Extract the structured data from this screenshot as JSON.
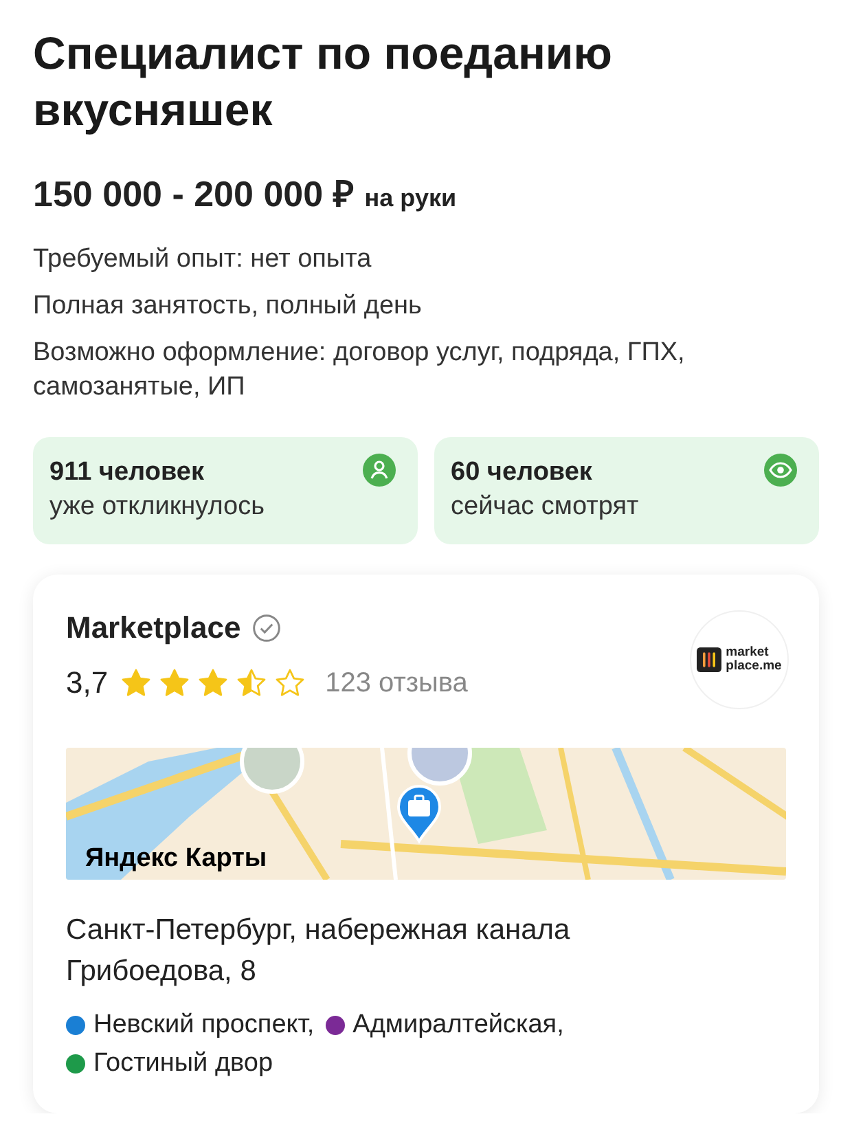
{
  "vacancy": {
    "title": "Специалист по поеданию вкусняшек",
    "salary": "150 000 - 200 000 ₽",
    "salary_note": "на руки"
  },
  "details": [
    "Требуемый опыт: нет опыта",
    "Полная занятость, полный день",
    "Возможно оформление: договор услуг, подряда, ГПХ, самозанятые, ИП"
  ],
  "stats": [
    {
      "kind": "person",
      "value": "911 человек",
      "label": "уже откликнулось"
    },
    {
      "kind": "eye",
      "value": "60 человек",
      "label": "сейчас смотрят"
    }
  ],
  "company": {
    "name": "Marketplace",
    "verified": true,
    "rating": "3,7",
    "stars": 3.5,
    "reviews": "123 отзыва",
    "logo_text": [
      "market",
      "place.me"
    ],
    "map": {
      "attribution": "Яндекс Карты"
    },
    "address": "Санкт-Петербург, набережная канала Грибоедова, 8",
    "metro": [
      {
        "name": "Невский проспект,",
        "color": "#1a7fd4"
      },
      {
        "name": "Адмиралтейская,",
        "color": "#7b2a96"
      },
      {
        "name": "Гостиный двор",
        "color": "#1e9a4a"
      }
    ]
  }
}
